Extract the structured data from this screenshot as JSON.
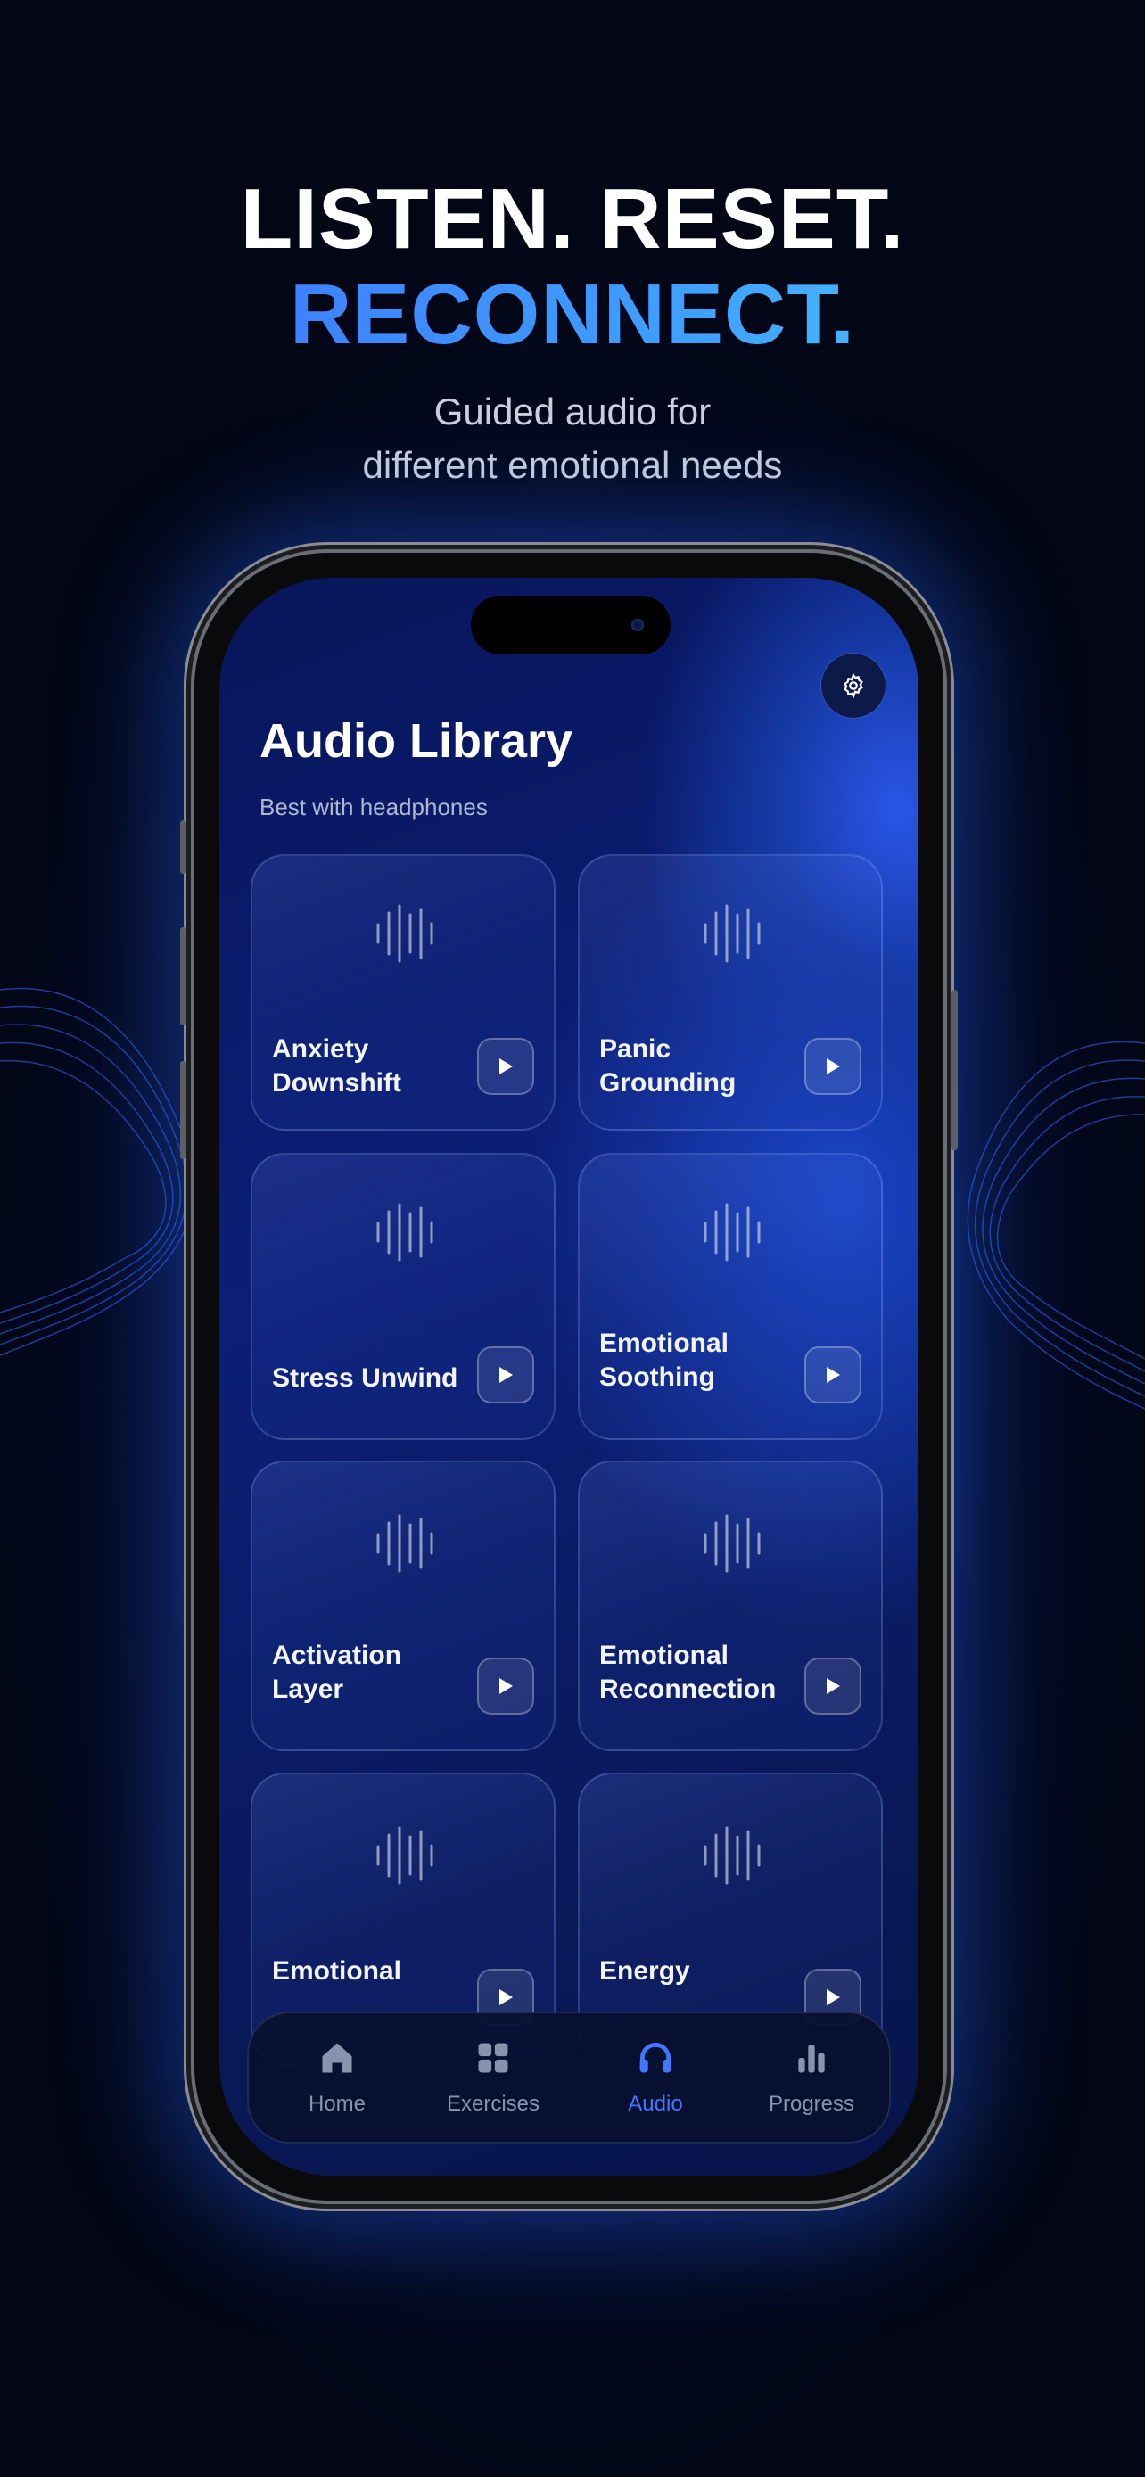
{
  "hero": {
    "line1": "LISTEN. RESET.",
    "line2": "RECONNECT.",
    "sub1": "Guided audio for",
    "sub2": "different emotional needs"
  },
  "screen": {
    "title": "Audio Library",
    "subtitle": "Best with headphones"
  },
  "cards": [
    {
      "label": "Anxiety\nDownshift"
    },
    {
      "label": "Panic\nGrounding"
    },
    {
      "label": "Stress Unwind"
    },
    {
      "label": "Emotional\nSoothing"
    },
    {
      "label": "Activation\nLayer"
    },
    {
      "label": "Emotional\nReconnection"
    },
    {
      "label": "Emotional"
    },
    {
      "label": "Energy"
    }
  ],
  "nav": {
    "items": [
      {
        "label": "Home",
        "icon": "home-icon"
      },
      {
        "label": "Exercises",
        "icon": "grid-icon"
      },
      {
        "label": "Audio",
        "icon": "headphones-icon",
        "active": true
      },
      {
        "label": "Progress",
        "icon": "bar-chart-icon"
      }
    ]
  },
  "colors": {
    "accent": "#3f78ff",
    "gradient_start": "#3b6cff",
    "gradient_end": "#4fd0ff",
    "background": "#020615"
  }
}
